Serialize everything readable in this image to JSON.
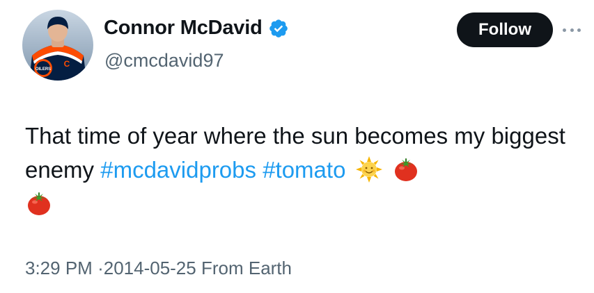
{
  "author": {
    "display_name": "Connor McDavid",
    "handle": "@cmcdavid97",
    "verified": true,
    "avatar_text": "OILERS",
    "jersey_letter": "C"
  },
  "actions": {
    "follow_label": "Follow",
    "more_icon": "more-horizontal-icon"
  },
  "tweet": {
    "text_prefix": "That time of year where the sun becomes my biggest enemy",
    "hashtags": [
      "#mcdavidprobs",
      "#tomato"
    ],
    "emojis": [
      "sun-with-face",
      "tomato",
      "tomato"
    ]
  },
  "meta": {
    "time": "3:29 PM",
    "separator": "·",
    "date": "2014-05-25",
    "source": "From Earth"
  },
  "colors": {
    "text": "#0f1419",
    "secondary": "#536471",
    "link": "#1d9bf0",
    "verified": "#1d9bf0",
    "button_bg": "#0f1419",
    "button_text": "#ffffff",
    "oilers_blue": "#041e42",
    "oilers_orange": "#fc4c02"
  }
}
